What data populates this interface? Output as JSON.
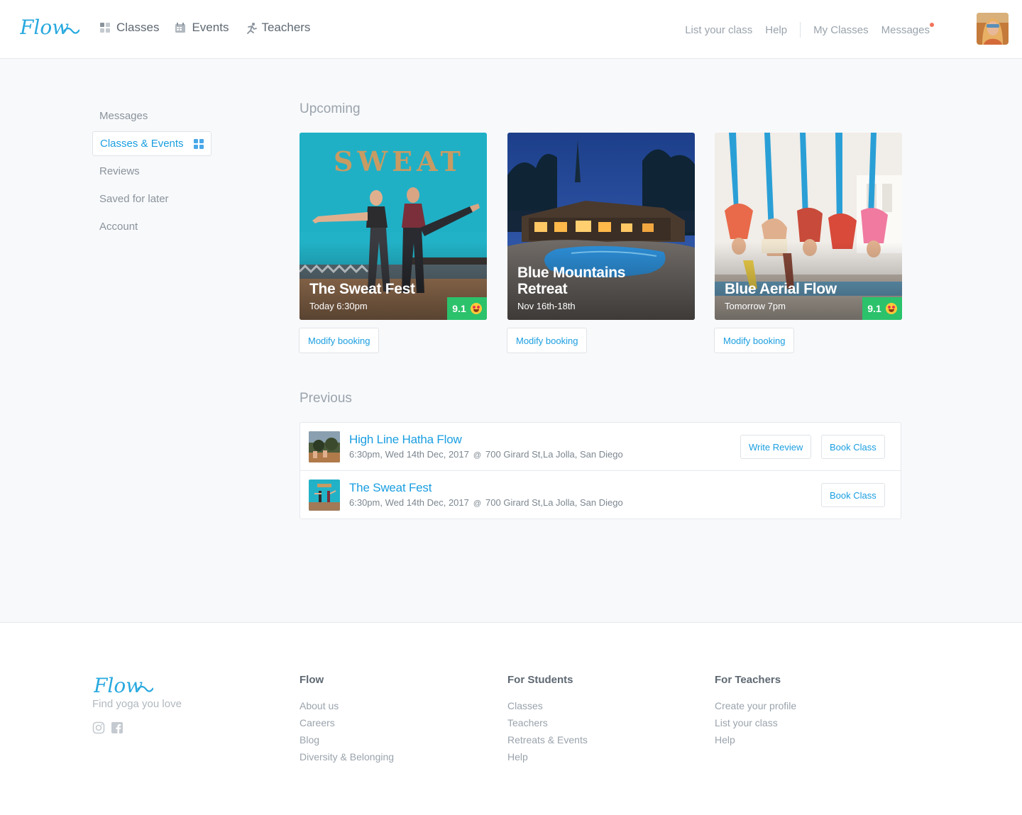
{
  "brand": {
    "logo_text": "Flow",
    "accent": "#1a9ee0",
    "score_green": "#2bc26b"
  },
  "header": {
    "nav": [
      {
        "label": "Classes",
        "icon": "grid-icon"
      },
      {
        "label": "Events",
        "icon": "calendar-icon"
      },
      {
        "label": "Teachers",
        "icon": "running-person-icon"
      }
    ],
    "right_links": {
      "list_class": "List your class",
      "help": "Help",
      "my_classes": "My Classes",
      "messages": "Messages"
    }
  },
  "sidebar": {
    "items": [
      {
        "label": "Messages"
      },
      {
        "label": "Classes & Events"
      },
      {
        "label": "Reviews"
      },
      {
        "label": "Saved for later"
      },
      {
        "label": "Account"
      }
    ]
  },
  "upcoming": {
    "title": "Upcoming",
    "cards": [
      {
        "title": "The Sweat Fest",
        "date": "Today 6:30pm",
        "score": "9.1",
        "button": "Modify booking",
        "sign": "SWEAT"
      },
      {
        "title": "Blue Mountains Retreat",
        "date": "Nov 16th-18th",
        "button": "Modify booking"
      },
      {
        "title": "Blue Aerial Flow",
        "date": "Tomorrow 7pm",
        "score": "9.1",
        "button": "Modify booking"
      }
    ]
  },
  "previous": {
    "title": "Previous",
    "rows": [
      {
        "name": "High Line Hatha Flow",
        "time": "6:30pm, Wed 14th Dec, 2017",
        "at": "@",
        "address": "700 Girard St,La Jolla, San Diego",
        "write_review": "Write Review",
        "book": "Book Class"
      },
      {
        "name": "The Sweat Fest",
        "time": "6:30pm, Wed 14th Dec, 2017",
        "at": "@",
        "address": "700 Girard St,La Jolla, San Diego",
        "book": "Book Class"
      }
    ]
  },
  "footer": {
    "tagline": "Find yoga you love",
    "columns": [
      {
        "heading": "Flow",
        "links": [
          "About us",
          "Careers",
          "Blog",
          "Diversity & Belonging"
        ]
      },
      {
        "heading": "For Students",
        "links": [
          "Classes",
          "Teachers",
          "Retreats & Events",
          "Help"
        ]
      },
      {
        "heading": "For Teachers",
        "links": [
          "Create your profile",
          "List your class",
          "Help"
        ]
      }
    ]
  }
}
